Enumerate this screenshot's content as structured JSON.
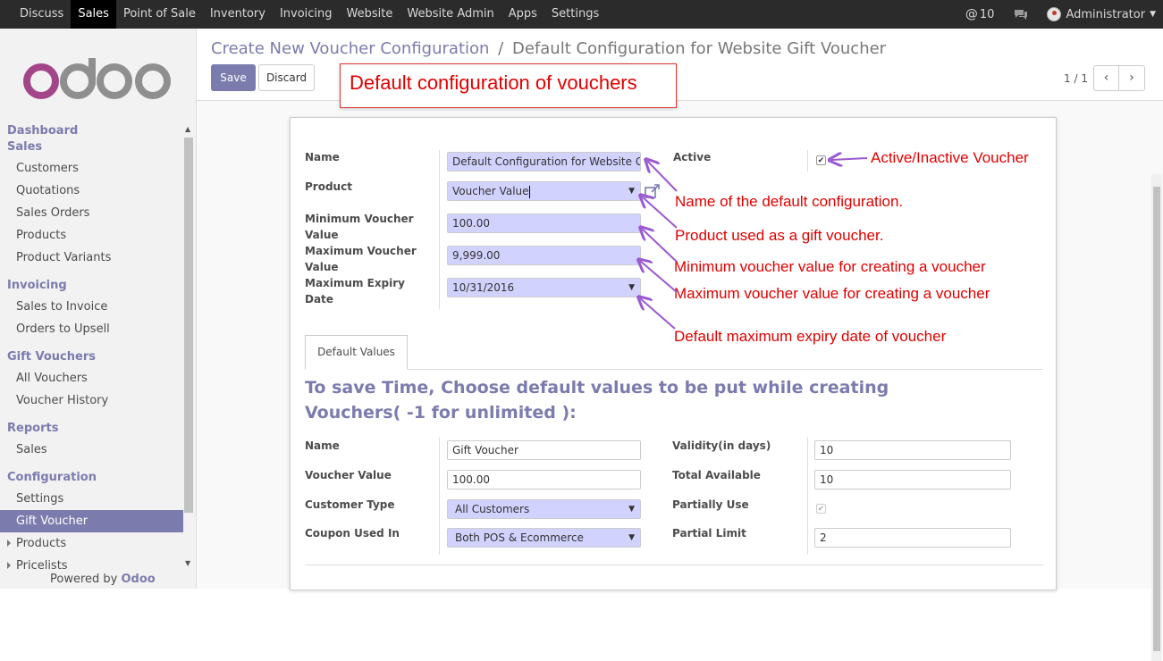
{
  "topbar": {
    "menu": [
      "Discuss",
      "Sales",
      "Point of Sale",
      "Inventory",
      "Invoicing",
      "Website",
      "Website Admin",
      "Apps",
      "Settings"
    ],
    "active_index": 1,
    "notifications": "10",
    "user": "Administrator"
  },
  "sidebar": {
    "logo_text": "odoo",
    "sections": [
      {
        "header": "Dashboard",
        "items": []
      },
      {
        "header": "Sales",
        "items": [
          "Customers",
          "Quotations",
          "Sales Orders",
          "Products",
          "Product Variants"
        ]
      },
      {
        "header": "Invoicing",
        "items": [
          "Sales to Invoice",
          "Orders to Upsell"
        ]
      },
      {
        "header": "Gift Vouchers",
        "items": [
          "All Vouchers",
          "Voucher History"
        ]
      },
      {
        "header": "Reports",
        "items": [
          "Sales"
        ]
      },
      {
        "header": "Configuration",
        "items": [
          "Settings",
          "Gift Voucher"
        ]
      }
    ],
    "selected": "Gift Voucher",
    "expandable": [
      "Products",
      "Pricelists"
    ],
    "powered_by": "Powered by",
    "powered_brand": "Odoo"
  },
  "breadcrumb": {
    "parent": "Create New Voucher Configuration",
    "separator": "/",
    "current": "Default Configuration for Website Gift Voucher"
  },
  "buttons": {
    "save": "Save",
    "discard": "Discard"
  },
  "pager": {
    "value": "1 / 1",
    "prev": "‹",
    "next": "›"
  },
  "form": {
    "name_label": "Name",
    "name_value": "Default Configuration for Website Gi",
    "product_label": "Product",
    "product_value": "Voucher Value",
    "min_label_1": "Minimum Voucher",
    "min_label_2": "Value",
    "min_value": "100.00",
    "max_label_1": "Maximum Voucher",
    "max_label_2": "Value",
    "max_value": "9,999.00",
    "expiry_label_1": "Maximum Expiry",
    "expiry_label_2": "Date",
    "expiry_value": "10/31/2016",
    "active_label": "Active",
    "active_checked": true
  },
  "tab": {
    "label": "Default Values"
  },
  "defaults": {
    "title": "To save Time, Choose default values to be put while creating Vouchers( -1 for unlimited ):",
    "name_label": "Name",
    "name_value": "Gift Voucher",
    "voucher_value_label": "Voucher Value",
    "voucher_value": "100.00",
    "customer_type_label": "Customer Type",
    "customer_type_value": "All Customers",
    "coupon_used_label": "Coupon Used In",
    "coupon_used_value": "Both POS & Ecommerce",
    "validity_label": "Validity(in days)",
    "validity_value": "10",
    "total_label": "Total Available",
    "total_value": "10",
    "partial_use_label": "Partially Use",
    "partial_limit_label": "Partial Limit",
    "partial_limit_value": "2"
  },
  "annotations": {
    "title": "Default configuration of vouchers",
    "active": "Active/Inactive Voucher",
    "name": "Name of the default configuration.",
    "product": "Product used as a gift voucher.",
    "min": "Minimum voucher value for creating a voucher",
    "max": "Maximum voucher value  for creating a voucher",
    "expiry": "Default maximum expiry date of voucher"
  }
}
